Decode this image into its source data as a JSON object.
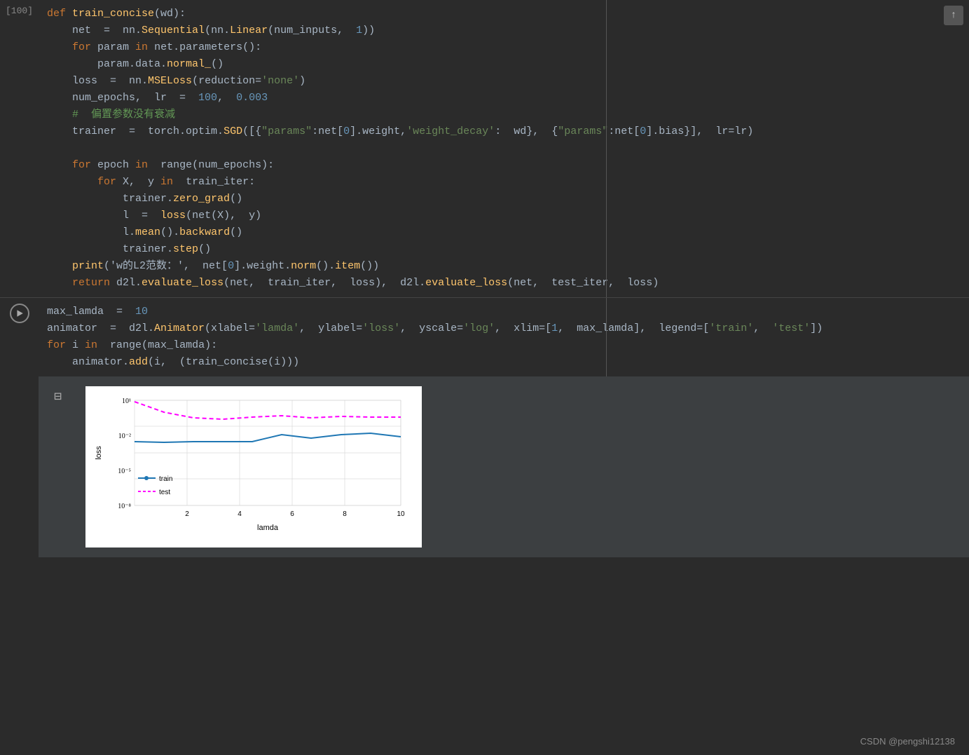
{
  "cell1": {
    "label": "[100]",
    "code_lines": [
      {
        "parts": [
          {
            "text": "def ",
            "cls": "kw"
          },
          {
            "text": "train_concise",
            "cls": "fn"
          },
          {
            "text": "(wd):",
            "cls": "plain"
          }
        ]
      },
      {
        "parts": [
          {
            "text": "    net  =  nn.",
            "cls": "plain"
          },
          {
            "text": "Sequential",
            "cls": "fn"
          },
          {
            "text": "(nn.",
            "cls": "plain"
          },
          {
            "text": "Linear",
            "cls": "fn"
          },
          {
            "text": "(num_inputs,  ",
            "cls": "plain"
          },
          {
            "text": "1",
            "cls": "num"
          },
          {
            "text": "))",
            "cls": "plain"
          }
        ]
      },
      {
        "parts": [
          {
            "text": "    ",
            "cls": "plain"
          },
          {
            "text": "for",
            "cls": "kw"
          },
          {
            "text": " param ",
            "cls": "plain"
          },
          {
            "text": "in",
            "cls": "kw"
          },
          {
            "text": " net.parameters():",
            "cls": "plain"
          }
        ]
      },
      {
        "parts": [
          {
            "text": "        param.data.",
            "cls": "plain"
          },
          {
            "text": "normal_",
            "cls": "fn"
          },
          {
            "text": "()",
            "cls": "plain"
          }
        ]
      },
      {
        "parts": [
          {
            "text": "    loss  =  nn.",
            "cls": "plain"
          },
          {
            "text": "MSELoss",
            "cls": "fn"
          },
          {
            "text": "(reduction=",
            "cls": "plain"
          },
          {
            "text": "'none'",
            "cls": "str"
          },
          {
            "text": ")",
            "cls": "plain"
          }
        ]
      },
      {
        "parts": [
          {
            "text": "    num_epochs,  lr  =  ",
            "cls": "plain"
          },
          {
            "text": "100",
            "cls": "num"
          },
          {
            "text": ",   ",
            "cls": "plain"
          },
          {
            "text": "0.003",
            "cls": "num"
          }
        ]
      },
      {
        "parts": [
          {
            "text": "    ",
            "cls": "plain"
          },
          {
            "text": "#  偏置参数没有衰减",
            "cls": "comment"
          }
        ]
      },
      {
        "parts": [
          {
            "text": "    trainer  =  torch.optim.",
            "cls": "plain"
          },
          {
            "text": "SGD",
            "cls": "fn"
          },
          {
            "text": "([{",
            "cls": "plain"
          },
          {
            "text": "\"params\"",
            "cls": "str"
          },
          {
            "text": ":net[",
            "cls": "plain"
          },
          {
            "text": "0",
            "cls": "num"
          },
          {
            "text": "].weight,",
            "cls": "plain"
          },
          {
            "text": "'weight_decay'",
            "cls": "str"
          },
          {
            "text": ":  wd},",
            "cls": "plain"
          },
          {
            "text": "  {",
            "cls": "plain"
          },
          {
            "text": "\"params\"",
            "cls": "str"
          },
          {
            "text": ":net[",
            "cls": "plain"
          },
          {
            "text": "0",
            "cls": "num"
          },
          {
            "text": "].bias}],  lr=lr)",
            "cls": "plain"
          }
        ]
      },
      {
        "parts": [
          {
            "text": "",
            "cls": "plain"
          }
        ]
      },
      {
        "parts": [
          {
            "text": "    ",
            "cls": "plain"
          },
          {
            "text": "for",
            "cls": "kw"
          },
          {
            "text": " epoch ",
            "cls": "plain"
          },
          {
            "text": "in",
            "cls": "kw"
          },
          {
            "text": "  range(num_epochs):",
            "cls": "plain"
          }
        ]
      },
      {
        "parts": [
          {
            "text": "        ",
            "cls": "plain"
          },
          {
            "text": "for",
            "cls": "kw"
          },
          {
            "text": " X,  y ",
            "cls": "plain"
          },
          {
            "text": "in",
            "cls": "kw"
          },
          {
            "text": "  train_iter:",
            "cls": "plain"
          }
        ]
      },
      {
        "parts": [
          {
            "text": "            trainer.",
            "cls": "plain"
          },
          {
            "text": "zero_grad",
            "cls": "fn"
          },
          {
            "text": "()",
            "cls": "plain"
          }
        ]
      },
      {
        "parts": [
          {
            "text": "            l  =  ",
            "cls": "plain"
          },
          {
            "text": "loss",
            "cls": "fn"
          },
          {
            "text": "(net(X),  y)",
            "cls": "plain"
          }
        ]
      },
      {
        "parts": [
          {
            "text": "            l.",
            "cls": "plain"
          },
          {
            "text": "mean",
            "cls": "fn"
          },
          {
            "text": "().",
            "cls": "plain"
          },
          {
            "text": "backward",
            "cls": "fn"
          },
          {
            "text": "()",
            "cls": "plain"
          }
        ]
      },
      {
        "parts": [
          {
            "text": "            trainer.",
            "cls": "plain"
          },
          {
            "text": "step",
            "cls": "fn"
          },
          {
            "text": "()",
            "cls": "plain"
          }
        ]
      },
      {
        "parts": [
          {
            "text": "    ",
            "cls": "plain"
          },
          {
            "text": "print",
            "cls": "fn"
          },
          {
            "text": "('w的L2范数：',  net[",
            "cls": "plain"
          },
          {
            "text": "0",
            "cls": "num"
          },
          {
            "text": "].weight.",
            "cls": "plain"
          },
          {
            "text": "norm",
            "cls": "fn"
          },
          {
            "text": "().",
            "cls": "plain"
          },
          {
            "text": "item",
            "cls": "fn"
          },
          {
            "text": "())",
            "cls": "plain"
          }
        ]
      },
      {
        "parts": [
          {
            "text": "    ",
            "cls": "plain"
          },
          {
            "text": "return",
            "cls": "kw"
          },
          {
            "text": " d2l.",
            "cls": "plain"
          },
          {
            "text": "evaluate_loss",
            "cls": "fn"
          },
          {
            "text": "(net,  train_iter,  loss),  d2l.",
            "cls": "plain"
          },
          {
            "text": "evaluate_loss",
            "cls": "fn"
          },
          {
            "text": "(net,  test_iter,  loss)",
            "cls": "plain"
          }
        ]
      }
    ]
  },
  "cell2": {
    "label": "",
    "code_lines": [
      {
        "parts": [
          {
            "text": "max_lamda  =  ",
            "cls": "plain"
          },
          {
            "text": "10",
            "cls": "num"
          }
        ]
      },
      {
        "parts": [
          {
            "text": "animator  =  d2l.",
            "cls": "plain"
          },
          {
            "text": "Animator",
            "cls": "fn"
          },
          {
            "text": "(xlabel=",
            "cls": "plain"
          },
          {
            "text": "'lamda'",
            "cls": "str"
          },
          {
            "text": ",  ylabel=",
            "cls": "plain"
          },
          {
            "text": "'loss'",
            "cls": "str"
          },
          {
            "text": ",  yscale=",
            "cls": "plain"
          },
          {
            "text": "'log'",
            "cls": "str"
          },
          {
            "text": ",  xlim=[",
            "cls": "plain"
          },
          {
            "text": "1",
            "cls": "num"
          },
          {
            "text": ",  max_lamda],  legend=[",
            "cls": "plain"
          },
          {
            "text": "'train'",
            "cls": "str"
          },
          {
            "text": ",  ",
            "cls": "plain"
          },
          {
            "text": "'test'",
            "cls": "str"
          },
          {
            "text": "])",
            "cls": "plain"
          }
        ]
      },
      {
        "parts": [
          {
            "text": "for",
            "cls": "kw"
          },
          {
            "text": " i ",
            "cls": "plain"
          },
          {
            "text": "in",
            "cls": "kw"
          },
          {
            "text": "  range(max_lamda):",
            "cls": "plain"
          }
        ]
      },
      {
        "parts": [
          {
            "text": "    animator.",
            "cls": "plain"
          },
          {
            "text": "add",
            "cls": "fn"
          },
          {
            "text": "(i,  (train_concise(i)))",
            "cls": "plain"
          }
        ]
      }
    ]
  },
  "chart": {
    "title": "",
    "xlabel": "lamda",
    "ylabel": "loss",
    "y_labels": [
      "10¹",
      "10⁻²",
      "10⁻⁵",
      "10⁻⁸"
    ],
    "x_labels": [
      "2",
      "4",
      "6",
      "8",
      "10"
    ],
    "legend": [
      {
        "label": "train",
        "color": "#1f77b4",
        "style": "solid"
      },
      {
        "label": "test",
        "color": "#ff00ff",
        "style": "dashed"
      }
    ],
    "train_data": [
      {
        "x": 1,
        "y": 0.003
      },
      {
        "x": 2,
        "y": 0.0025
      },
      {
        "x": 3,
        "y": 0.003
      },
      {
        "x": 4,
        "y": 0.0028
      },
      {
        "x": 5,
        "y": 0.003
      },
      {
        "x": 6,
        "y": 0.012
      },
      {
        "x": 7,
        "y": 0.006
      },
      {
        "x": 8,
        "y": 0.012
      },
      {
        "x": 9,
        "y": 0.015
      },
      {
        "x": 10,
        "y": 0.008
      }
    ],
    "test_data": [
      {
        "x": 1,
        "y": 8
      },
      {
        "x": 2,
        "y": 0.9
      },
      {
        "x": 3,
        "y": 0.3
      },
      {
        "x": 4,
        "y": 0.25
      },
      {
        "x": 5,
        "y": 0.35
      },
      {
        "x": 6,
        "y": 0.5
      },
      {
        "x": 7,
        "y": 0.3
      },
      {
        "x": 8,
        "y": 0.45
      },
      {
        "x": 9,
        "y": 0.4
      },
      {
        "x": 10,
        "y": 0.38
      }
    ]
  },
  "watermark": "CSDN @pengshi12138",
  "scroll_up_label": "↑",
  "output_icon": "⊟"
}
